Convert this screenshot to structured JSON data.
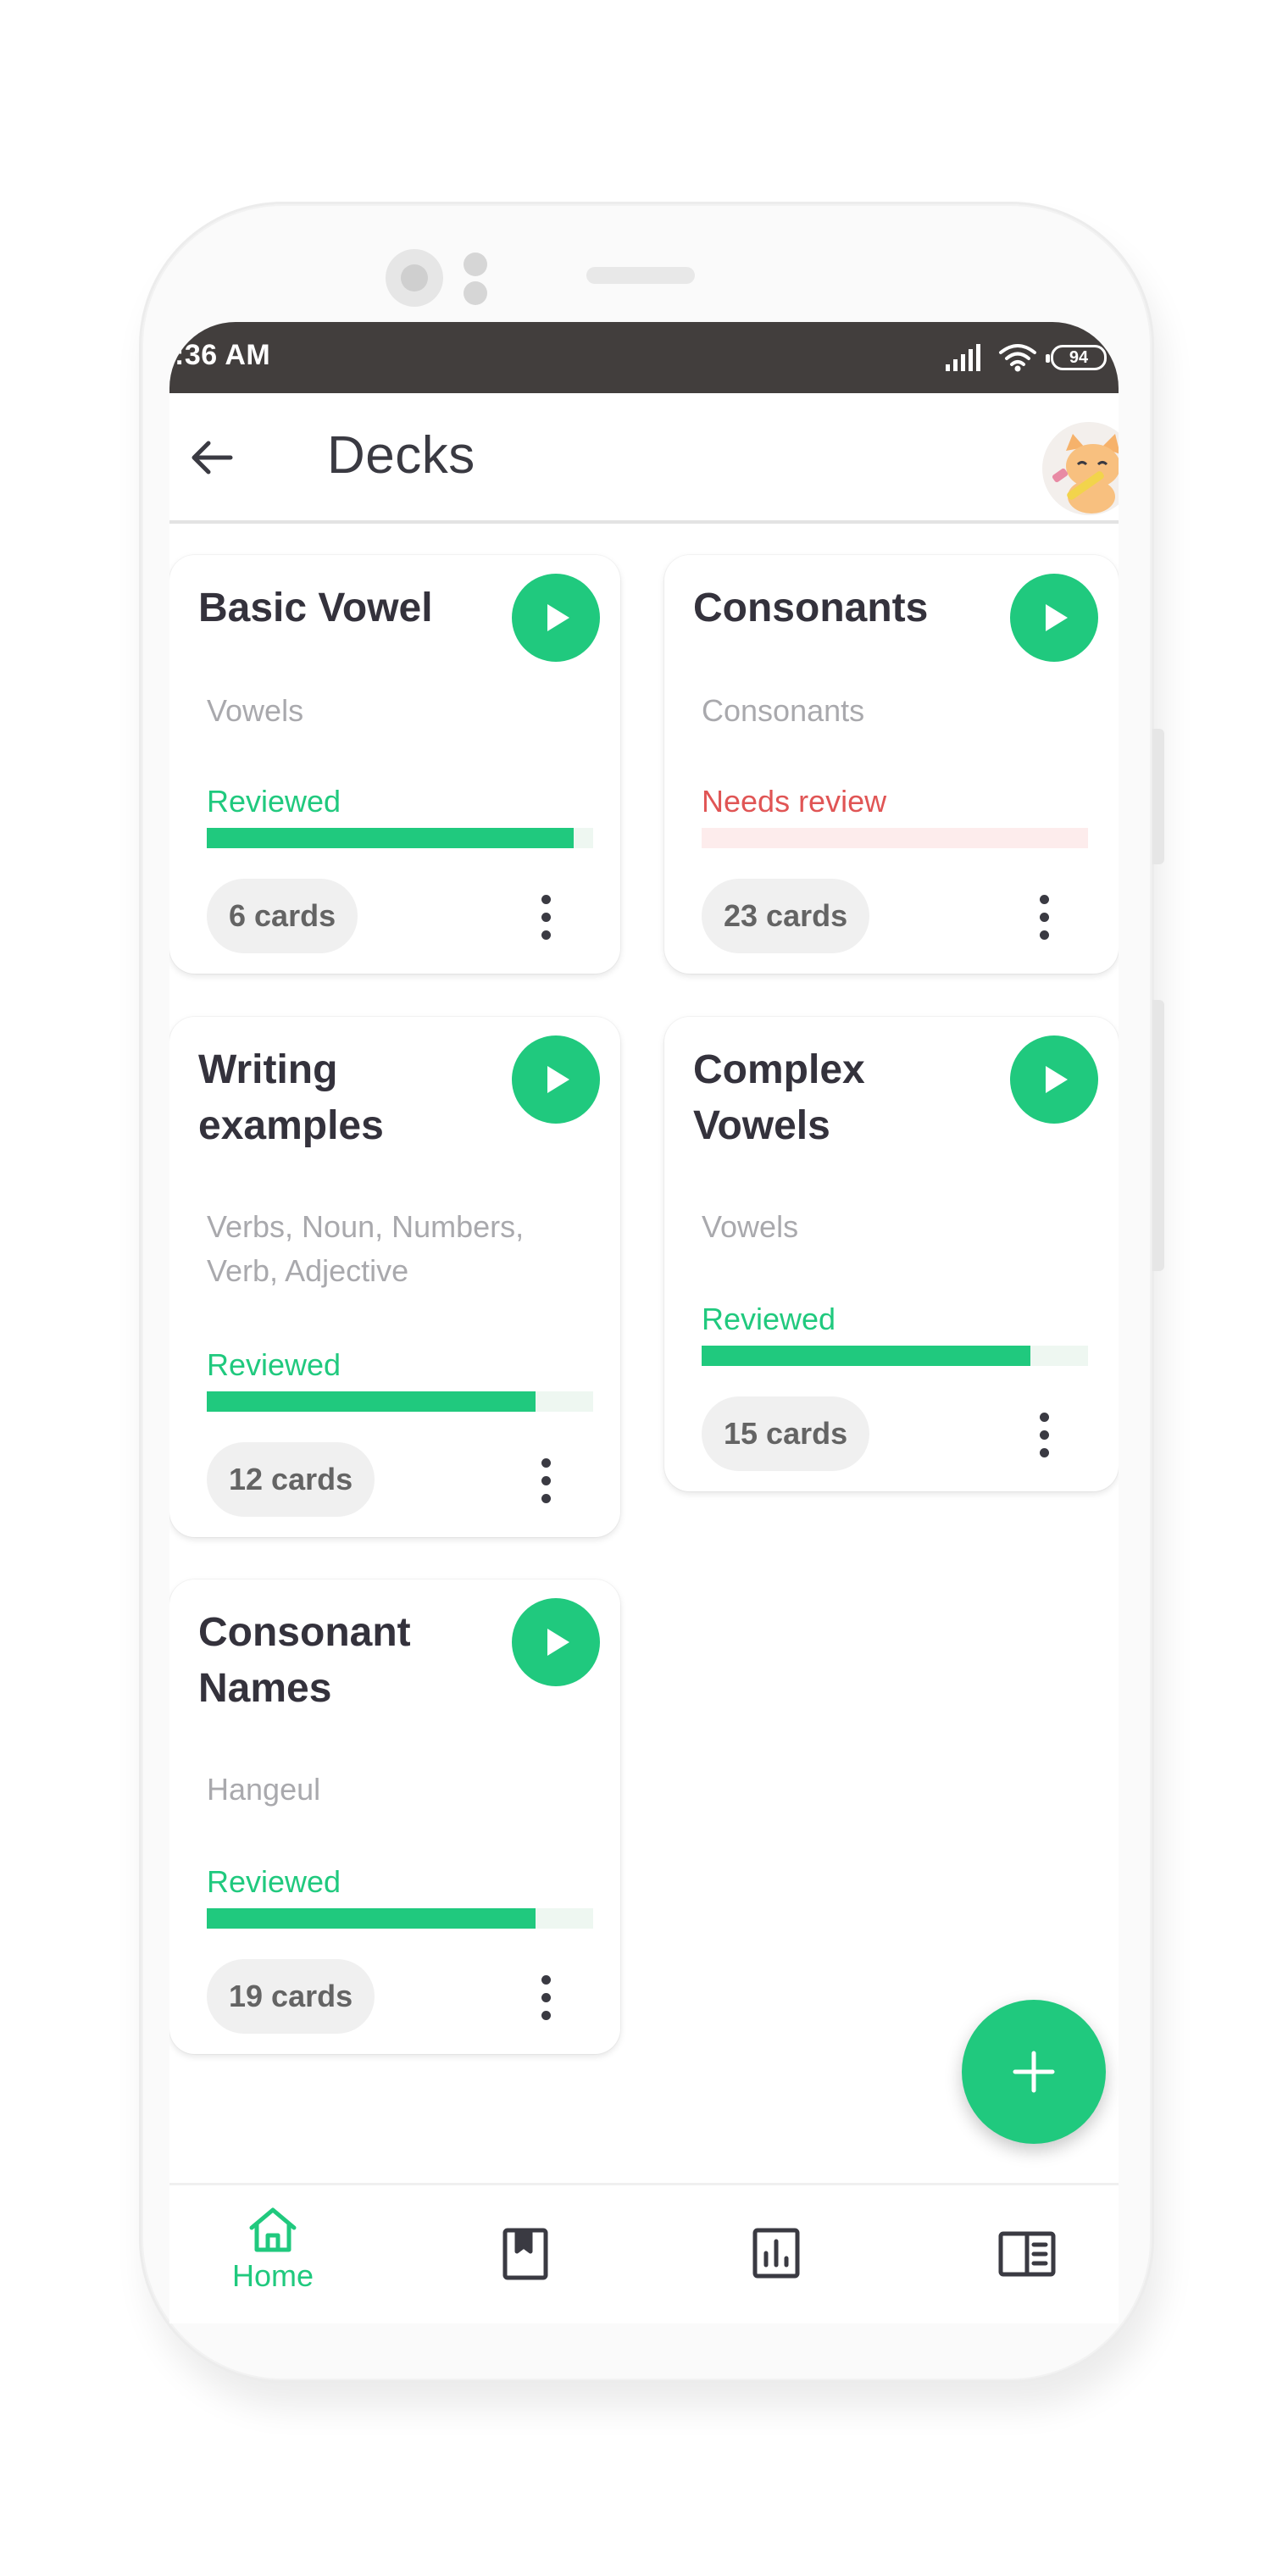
{
  "status_bar": {
    "time": ":36 AM",
    "battery": "94"
  },
  "app_bar": {
    "title": "Decks"
  },
  "decks": [
    {
      "title": "Basic Vowel",
      "tags": "Vowels",
      "status": "Reviewed",
      "status_color": "#20c97e",
      "progress": 0.95,
      "count": "6 cards"
    },
    {
      "title": "Consonants",
      "tags": "Consonants",
      "status": "Needs review",
      "status_color": "#e05555",
      "progress": 0.0,
      "count": "23 cards"
    },
    {
      "title": "Writing examples",
      "tags": "Verbs, Noun, Numbers, Verb, Adjective",
      "status": "Reviewed",
      "status_color": "#20c97e",
      "progress": 0.85,
      "count": "12 cards"
    },
    {
      "title": "Complex Vowels",
      "tags": "Vowels",
      "status": "Reviewed",
      "status_color": "#20c97e",
      "progress": 0.85,
      "count": "15 cards"
    },
    {
      "title": "Consonant Names",
      "tags": "Hangeul",
      "status": "Reviewed",
      "status_color": "#20c97e",
      "progress": 0.85,
      "count": "19 cards"
    }
  ],
  "bottom_nav": {
    "items": [
      {
        "label": "Home",
        "icon": "home-icon",
        "active": true
      },
      {
        "label": "",
        "icon": "bookmark-book-icon",
        "active": false
      },
      {
        "label": "",
        "icon": "bar-chart-icon",
        "active": false
      },
      {
        "label": "",
        "icon": "reader-icon",
        "active": false
      }
    ]
  },
  "colors": {
    "accent": "#20c97e",
    "danger": "#e05555",
    "status_bar": "#423e3d",
    "text": "#34323c"
  }
}
